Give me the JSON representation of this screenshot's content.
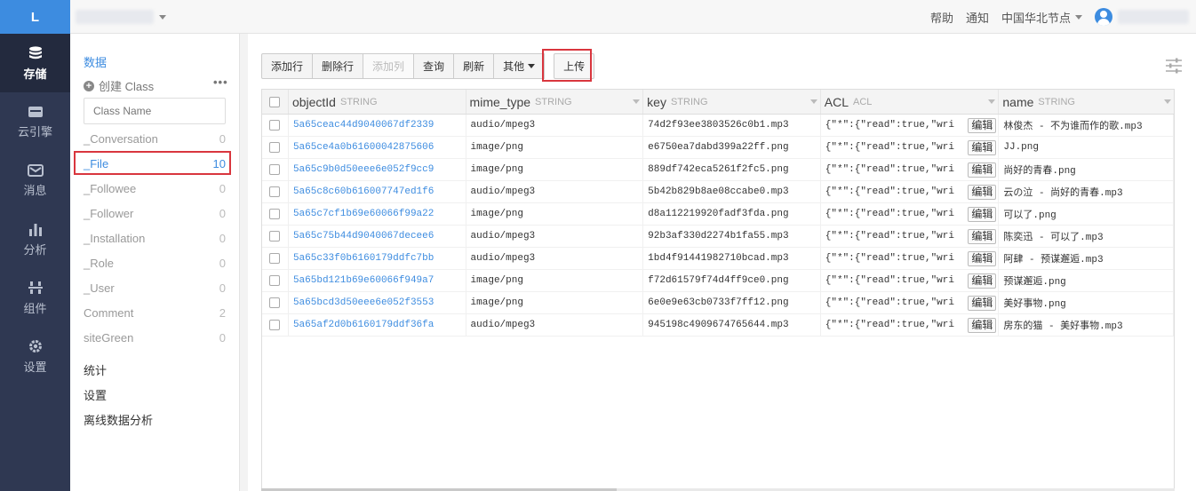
{
  "logo": "L",
  "topbar": {
    "help": "帮助",
    "notifications": "通知",
    "region": "中国华北节点"
  },
  "nav": [
    {
      "label": "存储",
      "icon": "database-icon",
      "active": true
    },
    {
      "label": "云引擎",
      "icon": "cloud-engine-icon",
      "active": false
    },
    {
      "label": "消息",
      "icon": "message-icon",
      "active": false
    },
    {
      "label": "分析",
      "icon": "bar-chart-icon",
      "active": false
    },
    {
      "label": "组件",
      "icon": "components-icon",
      "active": false
    },
    {
      "label": "设置",
      "icon": "gear-icon",
      "active": false
    }
  ],
  "classbar": {
    "title": "数据",
    "create_label": "创建 Class",
    "more": "•••",
    "search_placeholder": "Class Name",
    "classes": [
      {
        "name": "_Conversation",
        "count": "0"
      },
      {
        "name": "_File",
        "count": "10",
        "active": true
      },
      {
        "name": "_Followee",
        "count": "0"
      },
      {
        "name": "_Follower",
        "count": "0"
      },
      {
        "name": "_Installation",
        "count": "0"
      },
      {
        "name": "_Role",
        "count": "0"
      },
      {
        "name": "_User",
        "count": "0"
      },
      {
        "name": "Comment",
        "count": "2"
      },
      {
        "name": "siteGreen",
        "count": "0"
      }
    ],
    "links": [
      "统计",
      "设置",
      "离线数据分析"
    ]
  },
  "toolbar": {
    "add_row": "添加行",
    "delete_row": "删除行",
    "add_column": "添加列",
    "query": "查询",
    "refresh": "刷新",
    "other": "其他",
    "upload": "上传"
  },
  "grid": {
    "columns": [
      {
        "name": "objectId",
        "type": "STRING"
      },
      {
        "name": "mime_type",
        "type": "STRING"
      },
      {
        "name": "key",
        "type": "STRING"
      },
      {
        "name": "ACL",
        "type": "ACL"
      },
      {
        "name": "name",
        "type": "STRING"
      }
    ],
    "edit_label": "编辑",
    "rows": [
      {
        "objectId": "5a65ceac44d9040067df2339",
        "mime_type": "audio/mpeg3",
        "key": "74d2f93ee3803526c0b1.mp3",
        "acl": "{\"*\":{\"read\":true,\"wri",
        "name": "林俊杰 - 不为谁而作的歌.mp3"
      },
      {
        "objectId": "5a65ce4a0b61600042875606",
        "mime_type": "image/png",
        "key": "e6750ea7dabd399a22ff.png",
        "acl": "{\"*\":{\"read\":true,\"wri",
        "name": "JJ.png"
      },
      {
        "objectId": "5a65c9b0d50eee6e052f9cc9",
        "mime_type": "image/png",
        "key": "889df742eca5261f2fc5.png",
        "acl": "{\"*\":{\"read\":true,\"wri",
        "name": "尚好的青春.png"
      },
      {
        "objectId": "5a65c8c60b616007747ed1f6",
        "mime_type": "audio/mpeg3",
        "key": "5b42b829b8ae08ccabe0.mp3",
        "acl": "{\"*\":{\"read\":true,\"wri",
        "name": "云の泣 - 尚好的青春.mp3"
      },
      {
        "objectId": "5a65c7cf1b69e60066f99a22",
        "mime_type": "image/png",
        "key": "d8a112219920fadf3fda.png",
        "acl": "{\"*\":{\"read\":true,\"wri",
        "name": "可以了.png"
      },
      {
        "objectId": "5a65c75b44d9040067decee6",
        "mime_type": "audio/mpeg3",
        "key": "92b3af330d2274b1fa55.mp3",
        "acl": "{\"*\":{\"read\":true,\"wri",
        "name": "陈奕迅 - 可以了.mp3"
      },
      {
        "objectId": "5a65c33f0b6160179ddfc7bb",
        "mime_type": "audio/mpeg3",
        "key": "1bd4f91441982710bcad.mp3",
        "acl": "{\"*\":{\"read\":true,\"wri",
        "name": "阿肆 - 预谋邂逅.mp3"
      },
      {
        "objectId": "5a65bd121b69e60066f949a7",
        "mime_type": "image/png",
        "key": "f72d61579f74d4ff9ce0.png",
        "acl": "{\"*\":{\"read\":true,\"wri",
        "name": "预谋邂逅.png"
      },
      {
        "objectId": "5a65bcd3d50eee6e052f3553",
        "mime_type": "image/png",
        "key": "6e0e9e63cb0733f7ff12.png",
        "acl": "{\"*\":{\"read\":true,\"wri",
        "name": "美好事物.png"
      },
      {
        "objectId": "5a65af2d0b6160179ddf36fa",
        "mime_type": "audio/mpeg3",
        "key": "945198c4909674765644.mp3",
        "acl": "{\"*\":{\"read\":true,\"wri",
        "name": "房东的猫 - 美好事物.mp3"
      }
    ]
  },
  "colors": {
    "accent": "#3d8ce0",
    "nav_bg": "#2f3852",
    "highlight": "#d9363e"
  }
}
